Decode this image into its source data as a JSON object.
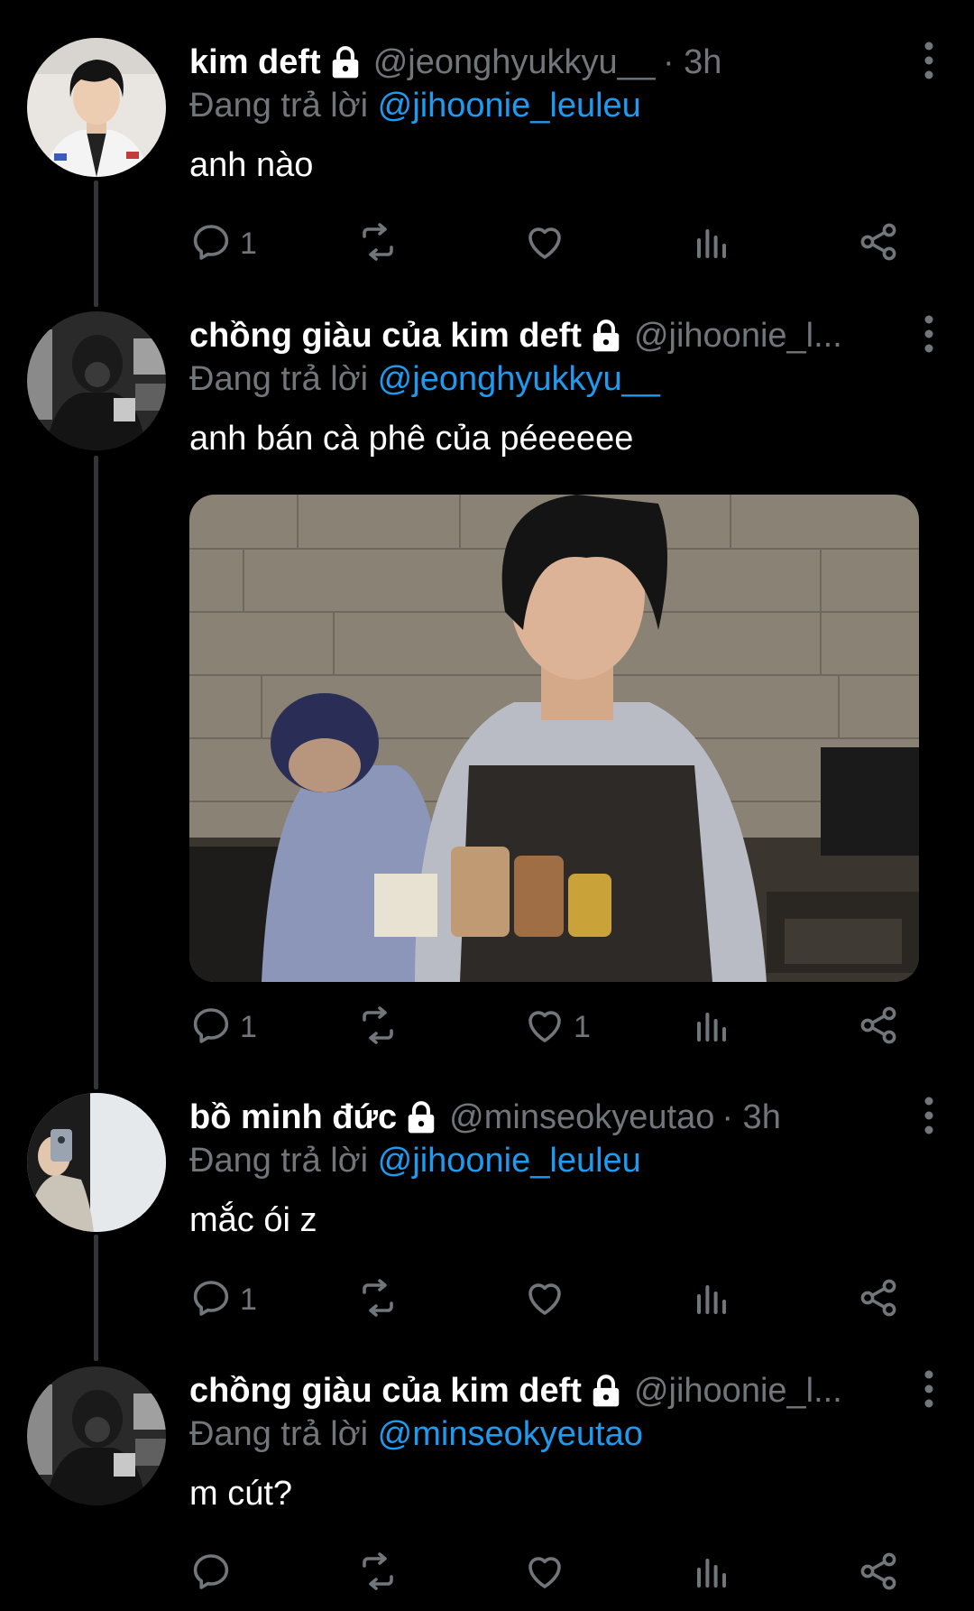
{
  "colors": {
    "background": "#000000",
    "muted": "#71767b",
    "link": "#1d9bf0",
    "text": "#e7e9ea",
    "thread_line": "#333639"
  },
  "tweets": [
    {
      "name": "kim deft",
      "handle": "@jeonghyukkyu__",
      "time": "· 3h",
      "reply_prefix": "Đang trả lời",
      "reply_to": "@jihoonie_leuleu",
      "text": "anh nào",
      "reply_count": "1",
      "like_count": ""
    },
    {
      "name": "chồng giàu của kim deft",
      "handle": "@jihoonie_l...",
      "time": "",
      "reply_prefix": "Đang trả lời",
      "reply_to": "@jeonghyukkyu__",
      "text": "anh bán cà phê của péeeeee",
      "reply_count": "1",
      "like_count": "1"
    },
    {
      "name": "bồ minh đức",
      "handle": "@minseokyeutao",
      "time": "· 3h",
      "reply_prefix": "Đang trả lời",
      "reply_to": "@jihoonie_leuleu",
      "text": "mắc ói z",
      "reply_count": "1",
      "like_count": ""
    },
    {
      "name": "chồng giàu của kim deft",
      "handle": "@jihoonie_l...",
      "time": "",
      "reply_prefix": "Đang trả lời",
      "reply_to": "@minseokyeutao",
      "text": "m cút?",
      "reply_count": "",
      "like_count": ""
    }
  ],
  "icons": {
    "lock": "lock-icon",
    "more": "more-vertical-icon",
    "reply": "reply-icon",
    "retweet": "retweet-icon",
    "like": "heart-icon",
    "views": "analytics-icon",
    "share": "share-icon"
  }
}
